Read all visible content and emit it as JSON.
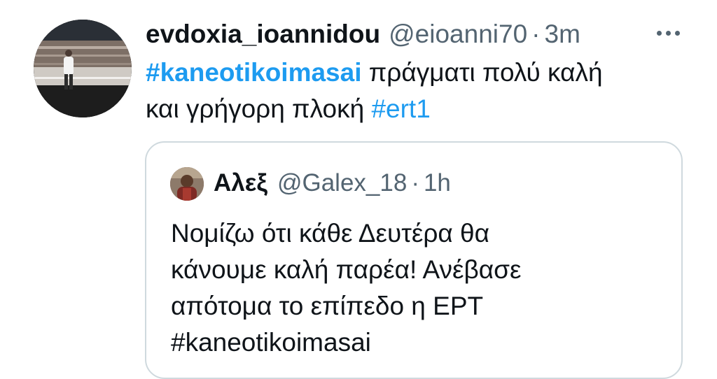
{
  "tweet": {
    "display_name": "evdoxia_ioannidou",
    "handle": "@eioanni70",
    "separator": "·",
    "time": "3m",
    "line1_hashtag": "#kaneotikoimasai",
    "line1_text": " πράγματι πολύ καλή",
    "line2_text": "και γρήγορη πλοκή ",
    "line2_hashtag": "#ert1",
    "more_icon": "more-horizontal-icon"
  },
  "quoted_tweet": {
    "display_name": "Αλεξ",
    "handle": "@Galex_18",
    "separator": "·",
    "time": "1h",
    "lines": [
      "Νομίζω ότι κάθε Δευτέρα θα",
      "κάνουμε καλή παρέα! Ανέβασε",
      "απότομα το επίπεδο η ΕΡΤ",
      "#kaneotikoimasai"
    ]
  },
  "colors": {
    "text": "#0f1419",
    "secondary": "#536471",
    "link": "#1d9bf0",
    "border": "#cfd9de"
  }
}
